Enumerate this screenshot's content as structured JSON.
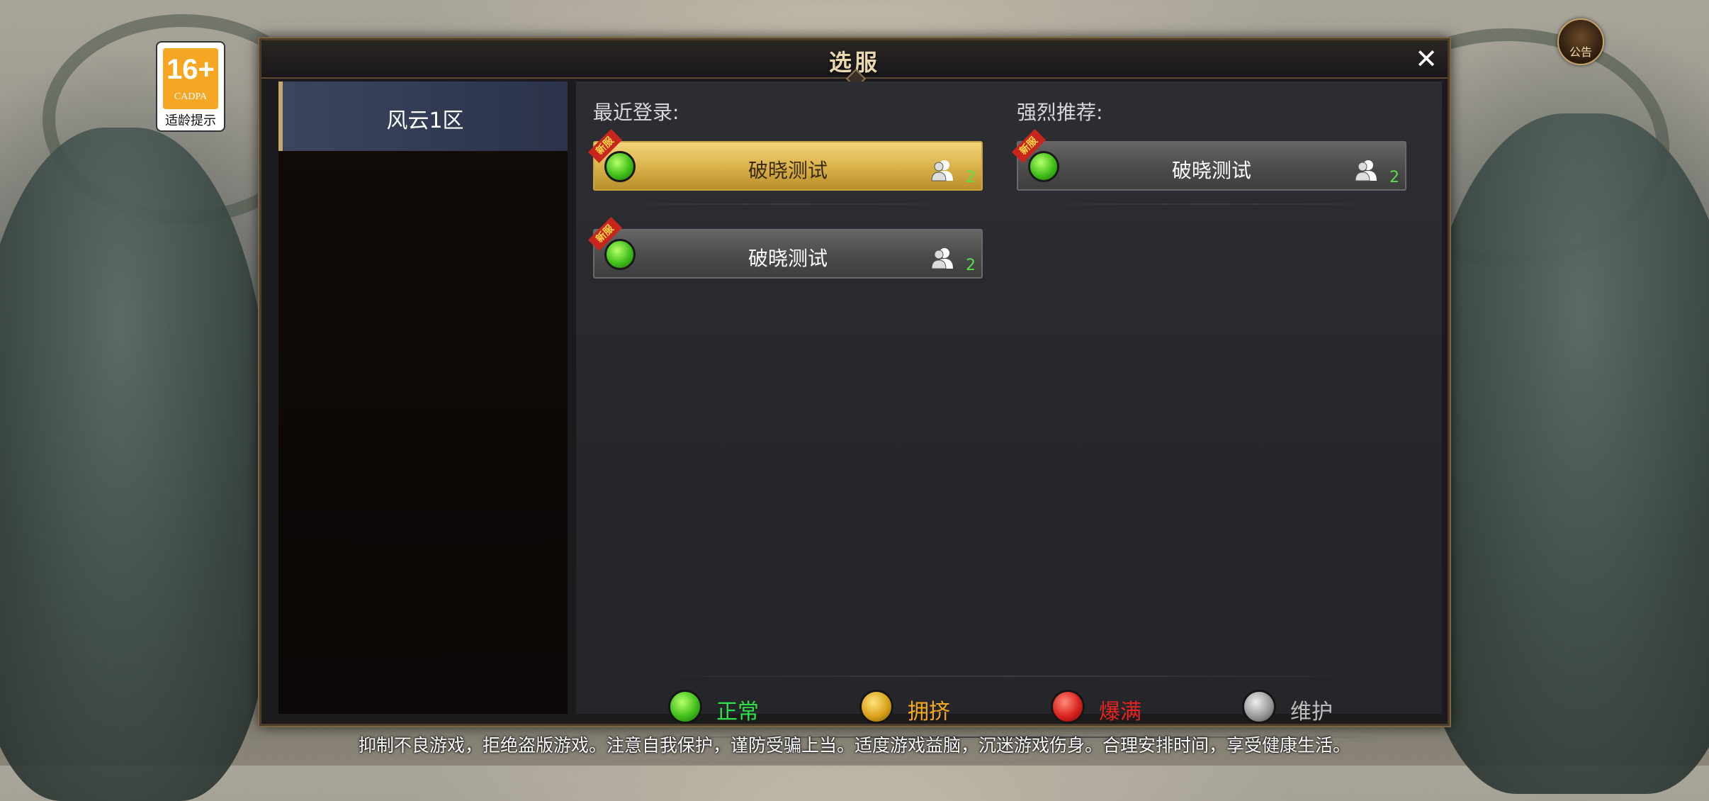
{
  "age_badge": {
    "rating": "16+",
    "org": "CADPA",
    "tip": "适龄提示"
  },
  "notice": {
    "label": "公告"
  },
  "dialog": {
    "title": "选服",
    "close_symbol": "✕"
  },
  "sidebar": {
    "zones": [
      {
        "label": "风云1区",
        "selected": true
      }
    ]
  },
  "sections": {
    "recent_label": "最近登录:",
    "recommend_label": "强烈推荐:"
  },
  "servers": {
    "recent": [
      {
        "name": "破晓测试",
        "tag": "新服",
        "status": "正常",
        "players": "2",
        "selected": true
      },
      {
        "name": "破晓测试",
        "tag": "新服",
        "status": "正常",
        "players": "2",
        "selected": false
      }
    ],
    "recommended": [
      {
        "name": "破晓测试",
        "tag": "新服",
        "status": "正常",
        "players": "2",
        "selected": false
      }
    ]
  },
  "legend": [
    {
      "label": "正常",
      "color": "#3fbf1a",
      "text_color": "#2fe04a"
    },
    {
      "label": "拥挤",
      "color": "#d9a21c",
      "text_color": "#f5a623"
    },
    {
      "label": "爆满",
      "color": "#d8231e",
      "text_color": "#e8231e"
    },
    {
      "label": "维护",
      "color": "#9a9a9a",
      "text_color": "#bdbdbd"
    }
  ],
  "footer": "抑制不良游戏，拒绝盗版游戏。注意自我保护，谨防受骗上当。适度游戏益脑，沉迷游戏伤身。合理安排时间，享受健康生活。"
}
